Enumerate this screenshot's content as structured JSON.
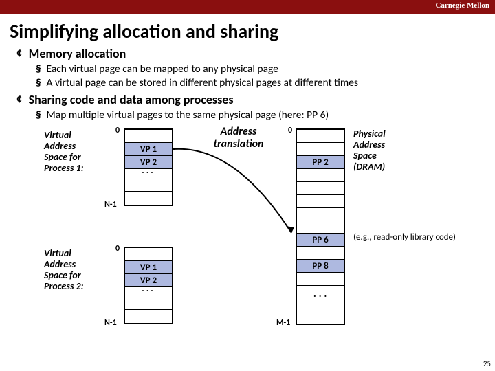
{
  "header": {
    "brand": "Carnegie Mellon"
  },
  "title": "Simplifying allocation and sharing",
  "bullets": {
    "b1": {
      "mark": "¢",
      "label": "Memory allocation"
    },
    "b1s1": {
      "mark": "§",
      "text": "Each virtual page can be mapped to any physical page"
    },
    "b1s2": {
      "mark": "§",
      "text": "A virtual page can be stored in different physical pages at different times"
    },
    "b2": {
      "mark": "¢",
      "label": "Sharing code and data among processes"
    },
    "b2s1": {
      "mark": "§",
      "text": "Map multiple virtual pages to the same physical page (here: PP 6)"
    }
  },
  "diagram": {
    "vas1_label": "Virtual\nAddress\nSpace for\nProcess 1:",
    "vas2_label": "Virtual\nAddress\nSpace for\nProcess 2:",
    "phys_label": "Physical\nAddress\nSpace\n(DRAM)",
    "eg_text": "(e.g., read-only library code)",
    "at_label": "Address\ntranslation",
    "vp1": "VP 1",
    "vp2": "VP 2",
    "pp2": "PP 2",
    "pp6": "PP 6",
    "pp8": "PP 8",
    "zero": "0",
    "n1": "N-1",
    "m1": "M-1",
    "dots": "..."
  },
  "page": "25"
}
